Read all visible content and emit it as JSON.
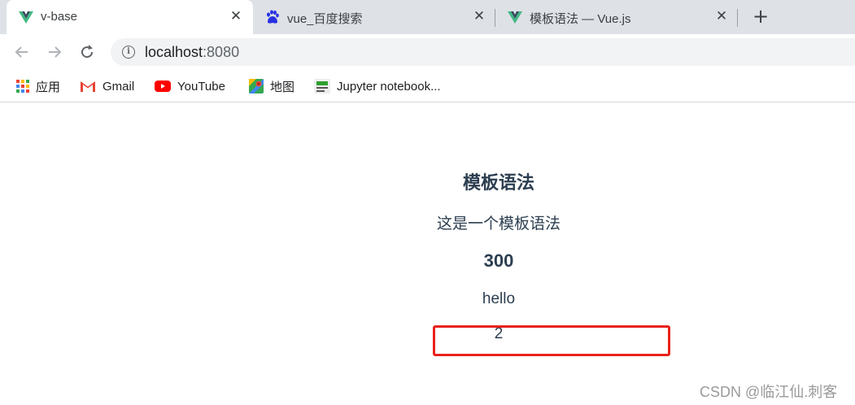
{
  "tabs": [
    {
      "title": "v-base",
      "icon": "vue-logo-icon",
      "active": true
    },
    {
      "title": "vue_百度搜索",
      "icon": "baidu-paw-icon",
      "active": false
    },
    {
      "title": "模板语法 — Vue.js",
      "icon": "vue-logo-icon",
      "active": false
    }
  ],
  "toolbar": {
    "back_icon": "back-arrow-icon",
    "forward_icon": "forward-arrow-icon",
    "reload_icon": "reload-icon",
    "url_host": "localhost",
    "url_port": ":8080"
  },
  "bookmarks": [
    {
      "label": "应用",
      "icon": "apps-grid-icon"
    },
    {
      "label": "Gmail",
      "icon": "gmail-icon"
    },
    {
      "label": "YouTube",
      "icon": "youtube-icon"
    },
    {
      "label": "地图",
      "icon": "maps-icon"
    },
    {
      "label": "Jupyter notebook...",
      "icon": "jupyter-icon"
    }
  ],
  "page": {
    "title": "模板语法",
    "description": "这是一个模板语法",
    "number": "300",
    "hello": "hello",
    "count": "2"
  },
  "watermark": "CSDN @临江仙.刺客",
  "colors": {
    "tab_strip": "#dee1e6",
    "vue_green": "#41b883",
    "vue_dark": "#35495e",
    "text": "#2c3e50",
    "highlight_border": "#e8211b"
  }
}
